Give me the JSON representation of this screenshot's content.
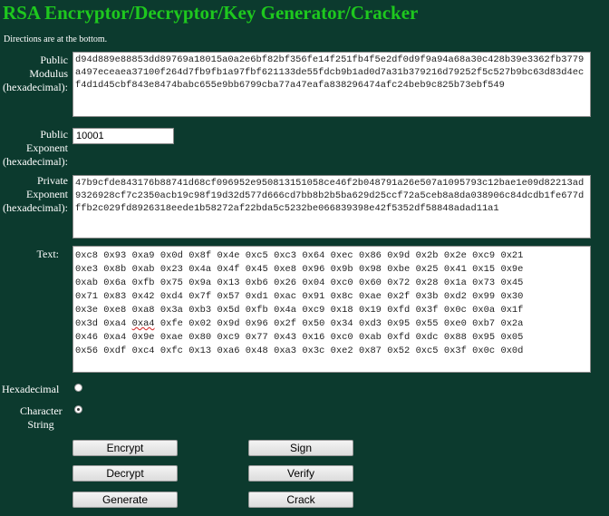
{
  "title": "RSA Encryptor/Decryptor/Key Generator/Cracker",
  "directions": "Directions are at the bottom.",
  "labels": {
    "modulus": [
      "Public",
      "Modulus",
      "(hexadecimal):"
    ],
    "exponent": [
      "Public",
      "Exponent",
      "(hexadecimal):"
    ],
    "private": [
      "Private",
      "Exponent",
      "(hexadecimal):"
    ],
    "text": "Text:",
    "hex": "Hexadecimal",
    "charstring": [
      "Character",
      "String"
    ]
  },
  "fields": {
    "modulus": "d94d889e88853dd89769a18015a0a2e6bf82bf356fe14f251fb4f5e2df0d9f9a94a68a30c428b39e3362fb3779a497eceaea37100f264d7fb9fb1a97fbf621133de55fdcb9b1ad0d7a31b379216d79252f5c527b9bc63d83d4ecf4d1d45cbf843e8474babc655e9bb6799cba77a47eafa838296474afc24beb9c825b73ebf549",
    "exponent": "10001",
    "private": "47b9cfde843176b88741d68cf096952e950813151058ce46f2b048791a26e507a1095793c12bae1e09d82213ad9326928cf7c2350acb19c98f19d32d577d666cd7bb8b2b5ba629d25ccf72a5ceb8a8da038906c84dcdb1fe677dffb2c029fd8926318eede1b58272af22bda5c5232be066839398e42f5352df58848adad11a1"
  },
  "text_rows": [
    [
      "0xc8",
      "0x93",
      "0xa9",
      "0x0d",
      "0x8f",
      "0x4e",
      "0xc5",
      "0xc3",
      "0x64",
      "0xec",
      "0x86",
      "0x9d",
      "0x2b",
      "0x2e",
      "0xc9",
      "0x21"
    ],
    [
      "0xe3",
      "0x8b",
      "0xab",
      "0x23",
      "0x4a",
      "0x4f",
      "0x45",
      "0xe8",
      "0x96",
      "0x9b",
      "0x98",
      "0xbe",
      "0x25",
      "0x41",
      "0x15",
      "0x9e"
    ],
    [
      "0xab",
      "0x6a",
      "0xfb",
      "0x75",
      "0x9a",
      "0x13",
      "0xb6",
      "0x26",
      "0x04",
      "0xc0",
      "0x60",
      "0x72",
      "0x28",
      "0x1a",
      "0x73",
      "0x45"
    ],
    [
      "0x71",
      "0x83",
      "0x42",
      "0xd4",
      "0x7f",
      "0x57",
      "0xd1",
      "0xac",
      "0x91",
      "0x8c",
      "0xae",
      "0x2f",
      "0x3b",
      "0xd2",
      "0x99",
      "0x30"
    ],
    [
      "0x3e",
      "0xe8",
      "0xa8",
      "0x3a",
      "0xb3",
      "0x5d",
      "0xfb",
      "0x4a",
      "0xc9",
      "0x18",
      "0x19",
      "0xfd",
      "0x3f",
      "0x0c",
      "0x0a",
      "0x1f"
    ],
    [
      "0x3d",
      "0xa4",
      "0xa4",
      "0xfe",
      "0x02",
      "0x9d",
      "0x96",
      "0x2f",
      "0x50",
      "0x34",
      "0xd3",
      "0x95",
      "0x55",
      "0xe0",
      "0xb7",
      "0x2a"
    ],
    [
      "0x46",
      "0xa4",
      "0x9e",
      "0xae",
      "0x80",
      "0xc9",
      "0x77",
      "0x43",
      "0x16",
      "0xc0",
      "0xab",
      "0xfd",
      "0xdc",
      "0x88",
      "0x95",
      "0x05"
    ],
    [
      "0x56",
      "0xdf",
      "0xc4",
      "0xfc",
      "0x13",
      "0xa6",
      "0x48",
      "0xa3",
      "0x3c",
      "0xe2",
      "0x87",
      "0x52",
      "0xc5",
      "0x3f",
      "0x0c",
      "0x0d"
    ]
  ],
  "radio_state": {
    "hexadecimal": false,
    "character_string": true
  },
  "buttons": {
    "encrypt": "Encrypt",
    "sign": "Sign",
    "decrypt": "Decrypt",
    "verify": "Verify",
    "generate": "Generate",
    "crack": "Crack"
  }
}
